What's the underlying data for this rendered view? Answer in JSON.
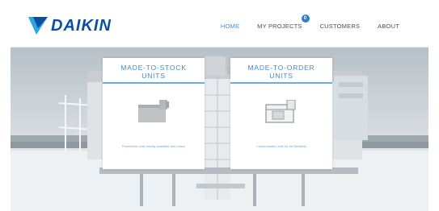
{
  "brand": {
    "name": "DAIKIN"
  },
  "nav": {
    "items": [
      {
        "label": "HOME",
        "active": true
      },
      {
        "label": "MY PROJECTS",
        "badge": "0"
      },
      {
        "label": "CUSTOMERS"
      },
      {
        "label": "ABOUT"
      }
    ]
  },
  "cards": [
    {
      "title_line1": "MADE-TO-STOCK",
      "title_line2": "UNITS",
      "caption": "Predefined units readily available from stock",
      "icon": "ahu-unit-icon"
    },
    {
      "title_line1": "MADE-TO-ORDER",
      "title_line2": "UNITS",
      "caption": "Customizable units for full flexibility",
      "icon": "ahu-unit-outline-icon"
    }
  ],
  "colors": {
    "brand_blue": "#0a4fa3",
    "accent": "#3f8ad0",
    "nav_active": "#3e8fd4",
    "text": "#4a4f55"
  }
}
